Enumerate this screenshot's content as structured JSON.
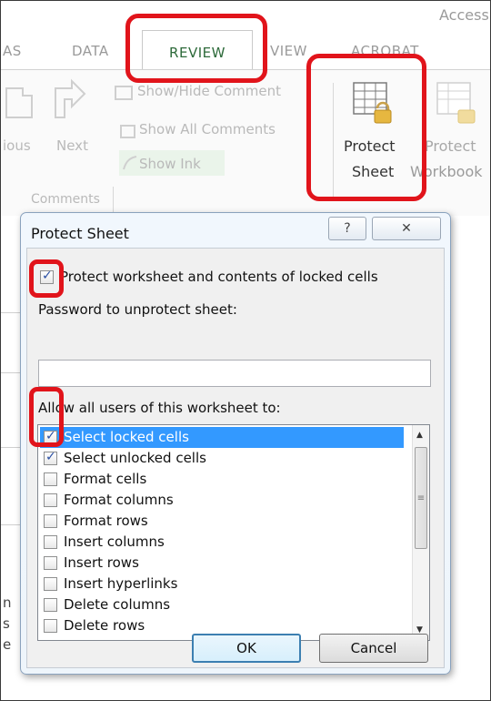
{
  "window": {
    "app_title_fragment": "Access"
  },
  "ribbon": {
    "tabs": {
      "left_fragment": "AS",
      "data": "DATA",
      "review": "REVIEW",
      "view": "VIEW",
      "acrobat": "ACROBAT"
    },
    "comments_group": {
      "previous_fragment": "ious",
      "next": "Next",
      "show_hide_comment": "Show/Hide Comment",
      "show_all_comments": "Show All Comments",
      "show_ink": "Show Ink",
      "group_label": "Comments"
    },
    "protect_sheet": {
      "line1": "Protect",
      "line2": "Sheet"
    },
    "protect_workbook": {
      "line1": "Protect",
      "line2": "Workbook"
    }
  },
  "sheet_fragments": [
    "n",
    "s",
    "e"
  ],
  "dialog": {
    "title": "Protect Sheet",
    "help_glyph": "?",
    "close_glyph": "✕",
    "protect_checkbox": {
      "label": "Protect worksheet and contents of locked cells",
      "checked": true
    },
    "password": {
      "label": "Password to unprotect sheet:",
      "value": ""
    },
    "allow_label": "Allow all users of this worksheet to:",
    "permissions": [
      {
        "label": "Select locked cells",
        "checked": true,
        "selected": true
      },
      {
        "label": "Select unlocked cells",
        "checked": true,
        "selected": false
      },
      {
        "label": "Format cells",
        "checked": false,
        "selected": false
      },
      {
        "label": "Format columns",
        "checked": false,
        "selected": false
      },
      {
        "label": "Format rows",
        "checked": false,
        "selected": false
      },
      {
        "label": "Insert columns",
        "checked": false,
        "selected": false
      },
      {
        "label": "Insert rows",
        "checked": false,
        "selected": false
      },
      {
        "label": "Insert hyperlinks",
        "checked": false,
        "selected": false
      },
      {
        "label": "Delete columns",
        "checked": false,
        "selected": false
      },
      {
        "label": "Delete rows",
        "checked": false,
        "selected": false
      }
    ],
    "ok_label": "OK",
    "cancel_label": "Cancel"
  },
  "colors": {
    "highlight_red": "#e1141b",
    "active_tab_text": "#2d6a3a",
    "selection_blue": "#3399ff"
  }
}
